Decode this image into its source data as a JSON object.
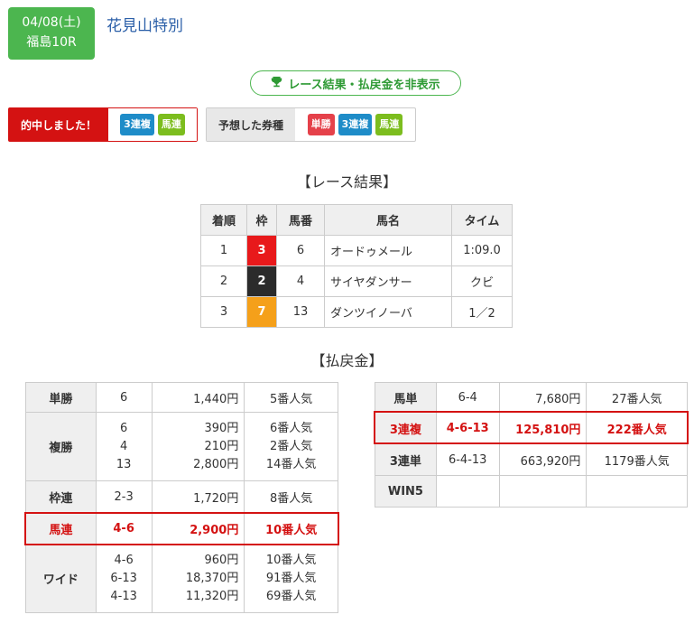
{
  "header": {
    "date": "04/08(土)",
    "venue_race": "福島10R",
    "race_name": "花見山特別"
  },
  "toggle": {
    "label": "レース結果・払戻金を非表示",
    "icon": "trophy-icon"
  },
  "hit": {
    "label": "的中しました！",
    "tags": [
      "3連複",
      "馬連"
    ]
  },
  "predicted": {
    "label": "予想した券種",
    "tags": [
      "単勝",
      "3連複",
      "馬連"
    ]
  },
  "results": {
    "heading": "【レース結果】",
    "headers": [
      "着順",
      "枠",
      "馬番",
      "馬名",
      "タイム"
    ],
    "rows": [
      {
        "pos": "1",
        "waku": "3",
        "uma": "6",
        "name": "オードゥメール",
        "time": "1:09.0",
        "waku_color": "#e8191b"
      },
      {
        "pos": "2",
        "waku": "2",
        "uma": "4",
        "name": "サイヤダンサー",
        "time": "クビ",
        "waku_color": "#2b2b2b"
      },
      {
        "pos": "3",
        "waku": "7",
        "uma": "13",
        "name": "ダンツイノーバ",
        "time": "1／2",
        "waku_color": "#f5a01a"
      }
    ]
  },
  "payout": {
    "heading": "【払戻金】",
    "left": {
      "tansho": {
        "label": "単勝",
        "combo": "6",
        "amount": "1,440円",
        "pop": "5番人気"
      },
      "fukusho": {
        "label": "複勝",
        "combos": [
          "6",
          "4",
          "13"
        ],
        "amounts": [
          "390円",
          "210円",
          "2,800円"
        ],
        "pops": [
          "6番人気",
          "2番人気",
          "14番人気"
        ]
      },
      "wakuren": {
        "label": "枠連",
        "combo": "2-3",
        "amount": "1,720円",
        "pop": "8番人気"
      },
      "umaren": {
        "label": "馬連",
        "combo": "4-6",
        "amount": "2,900円",
        "pop": "10番人気"
      },
      "wide": {
        "label": "ワイド",
        "combos": [
          "4-6",
          "6-13",
          "4-13"
        ],
        "amounts": [
          "960円",
          "18,370円",
          "11,320円"
        ],
        "pops": [
          "10番人気",
          "91番人気",
          "69番人気"
        ]
      }
    },
    "right": {
      "umatan": {
        "label": "馬単",
        "combo": "6-4",
        "amount": "7,680円",
        "pop": "27番人気"
      },
      "sanrenpuku": {
        "label": "3連複",
        "combo": "4-6-13",
        "amount": "125,810円",
        "pop": "222番人気"
      },
      "sanrentan": {
        "label": "3連単",
        "combo": "6-4-13",
        "amount": "663,920円",
        "pop": "1179番人気"
      },
      "win5": {
        "label": "WIN5",
        "combo": "",
        "amount": "",
        "pop": ""
      }
    }
  }
}
